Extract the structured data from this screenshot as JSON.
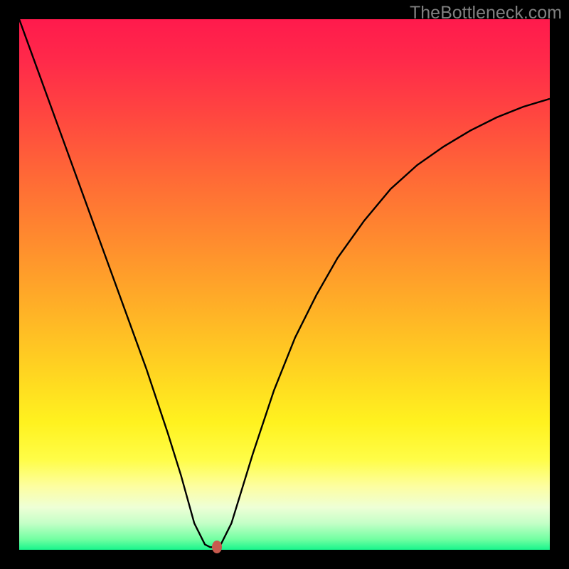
{
  "watermark": "TheBottleneck.com",
  "colors": {
    "frame": "#000000",
    "curve": "#000000",
    "dot": "#c75a4e",
    "gradient_top": "#ff1a4c",
    "gradient_bottom": "#18f58c"
  },
  "chart_data": {
    "type": "line",
    "title": "",
    "xlabel": "",
    "ylabel": "",
    "xlim": [
      0,
      100
    ],
    "ylim": [
      0,
      100
    ],
    "note": "Axes carry no tick labels in the source image; values below are read as percentages of the plot area width (x) and height above baseline (y).",
    "series": [
      {
        "name": "curve",
        "x": [
          0,
          4,
          8,
          12,
          16,
          20,
          24,
          28,
          30.5,
          33,
          35,
          36,
          37,
          38,
          40,
          44,
          48,
          52,
          56,
          60,
          65,
          70,
          75,
          80,
          85,
          90,
          95,
          100
        ],
        "y": [
          100,
          89,
          78,
          67,
          56,
          45,
          34,
          22,
          14,
          5,
          1,
          0.5,
          0.5,
          1,
          5,
          18,
          30,
          40,
          48,
          55,
          62,
          68,
          72.5,
          76,
          79,
          81.5,
          83.5,
          85
        ]
      }
    ],
    "marker": {
      "x": 37.3,
      "y": 0.5
    },
    "grid": false,
    "legend": false
  }
}
